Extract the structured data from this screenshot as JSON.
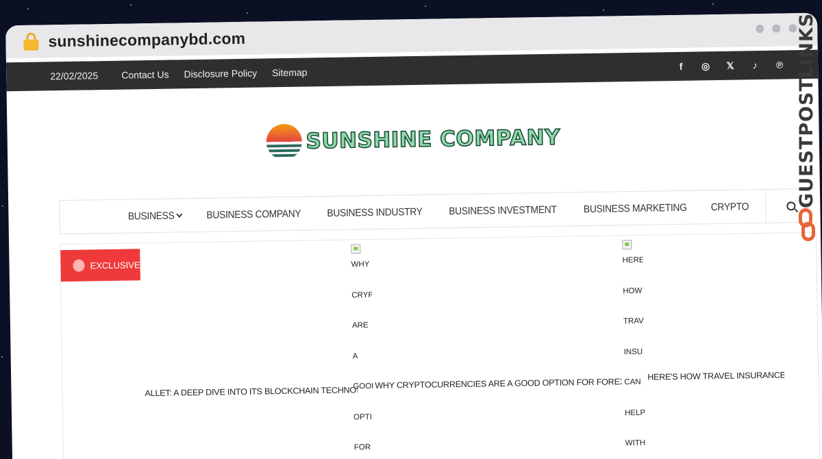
{
  "browser": {
    "url": "sunshinecompanybd.com"
  },
  "topbar": {
    "date": "22/02/2025",
    "links": [
      "Contact Us",
      "Disclosure Policy",
      "Sitemap"
    ],
    "social": [
      {
        "icon": "facebook-icon",
        "glyph": "f"
      },
      {
        "icon": "instagram-icon",
        "glyph": "◎"
      },
      {
        "icon": "x-icon",
        "glyph": "𝕏"
      },
      {
        "icon": "tiktok-icon",
        "glyph": "♪"
      },
      {
        "icon": "pinterest-icon",
        "glyph": "℗"
      }
    ]
  },
  "logo": {
    "text": "SUNSHINE COMPANY"
  },
  "nav": {
    "items": [
      "Business",
      "Business Company",
      "Business Industry",
      "Business Investment",
      "Business Marketing",
      "Crypto"
    ]
  },
  "content": {
    "badge": "EXCLUSIVE",
    "headline1": "ALLET: A DEEP DIVE INTO ITS BLOCKCHAIN TECHNOLOGY",
    "col2_words": [
      "WHY",
      "CRYF",
      "ARE",
      "A",
      "GOOI",
      "OPTI",
      "FOR"
    ],
    "headline2": "WHY CRYPTOCURRENCIES ARE A GOOD OPTION FOR FOREX TRADING",
    "col3_words": [
      "HERE",
      "HOW",
      "TRAV",
      "INSU",
      "CAN",
      "HELP",
      "WITH"
    ],
    "headline3": "HERE'S HOW TRAVEL INSURANCE CAN HE"
  },
  "watermark": {
    "text": "GUESTPOSTLINKS"
  },
  "colors": {
    "topbar": "#2f2f2f",
    "badge": "#ee3a3a",
    "logo_fill": "#8fd9a8",
    "logo_stroke": "#1c4d3d",
    "link_icon": "#e8643a"
  }
}
